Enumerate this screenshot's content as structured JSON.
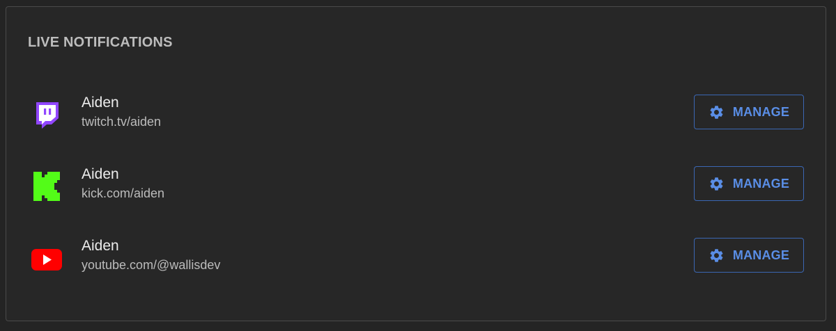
{
  "section": {
    "title": "LIVE NOTIFICATIONS"
  },
  "accounts": [
    {
      "platform_icon": "twitch-icon",
      "name": "Aiden",
      "url": "twitch.tv/aiden",
      "button_label": "MANAGE",
      "brand_color": "#9146ff"
    },
    {
      "platform_icon": "kick-icon",
      "name": "Aiden",
      "url": "kick.com/aiden",
      "button_label": "MANAGE",
      "brand_color": "#53fc18"
    },
    {
      "platform_icon": "youtube-icon",
      "name": "Aiden",
      "url": "youtube.com/@wallisdev",
      "button_label": "MANAGE",
      "brand_color": "#ff0000"
    }
  ],
  "colors": {
    "background": "#242424",
    "panel": "#272727",
    "accent": "#5a8ee6",
    "button_border": "#3b67b4"
  }
}
